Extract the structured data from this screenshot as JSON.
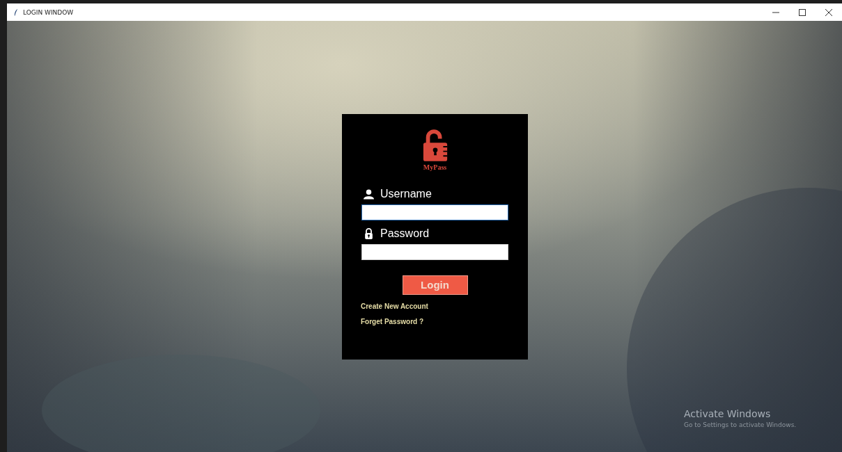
{
  "window": {
    "title": "LOGIN WINDOW"
  },
  "login_card": {
    "logo_text": "MyPass",
    "fields": [
      {
        "kind": "user",
        "label": "Username",
        "focused": true
      },
      {
        "kind": "lock",
        "label": "Password",
        "focused": false
      }
    ],
    "button": "Login",
    "links": [
      "Create New Account",
      "Forget Password ?"
    ]
  },
  "activation_notice": {
    "title": "Activate Windows",
    "message": "Go to Settings to activate Windows."
  }
}
